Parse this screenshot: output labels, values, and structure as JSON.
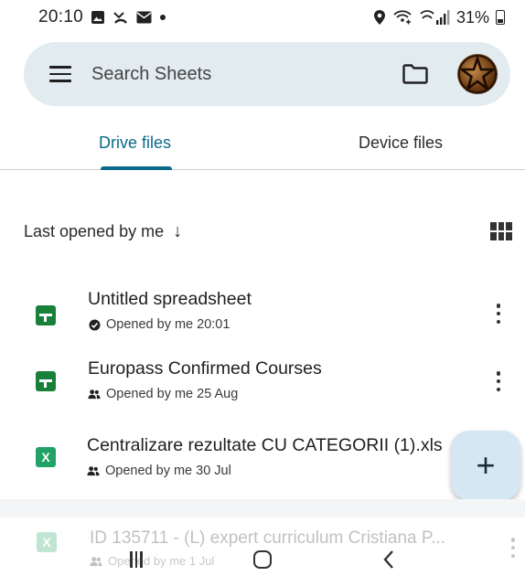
{
  "status_bar": {
    "time": "20:10",
    "battery": "31%",
    "left_icons": [
      "gallery-icon",
      "missed-call-icon",
      "email-icon",
      "dot-icon"
    ],
    "right_icons": [
      "location-icon",
      "wifi-calling-icon",
      "signal-icon",
      "battery-icon"
    ]
  },
  "search": {
    "placeholder": "Search Sheets"
  },
  "tabs": [
    {
      "label": "Drive files",
      "active": true
    },
    {
      "label": "Device files",
      "active": false
    }
  ],
  "sort": {
    "label": "Last opened by me",
    "arrow": "↓"
  },
  "files": [
    {
      "name": "Untitled spreadsheet",
      "meta": "Opened by me 20:01",
      "type": "sheets",
      "meta_icon": "check-circle-icon"
    },
    {
      "name": "Europass Confirmed Courses",
      "meta": "Opened by me 25 Aug",
      "type": "sheets",
      "meta_icon": "shared-icon"
    },
    {
      "name": "Centralizare rezultate CU CATEGORII (1).xls",
      "meta": "Opened by me 30 Jul",
      "type": "excel",
      "meta_icon": "shared-icon"
    },
    {
      "name": "ID 135711 - (L) expert curriculum Cristiana P...",
      "meta": "Opened by me 1 Jul",
      "type": "excel",
      "meta_icon": "shared-icon"
    }
  ],
  "fab": {
    "label": "+"
  },
  "excel_glyph": "X",
  "colors": {
    "accent": "#0b6a8a",
    "search_bg": "#e2ebf0",
    "sheets_green": "#188038",
    "excel_green": "#21a366",
    "fab_bg": "#d4e7f3"
  }
}
